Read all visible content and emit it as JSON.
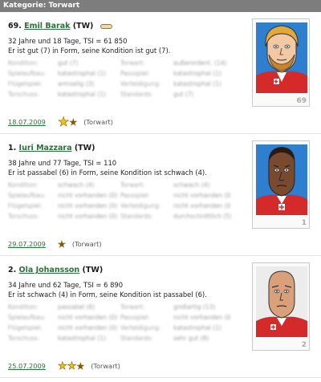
{
  "category": {
    "title": "Kategorie: Torwart"
  },
  "players": [
    {
      "rank": "69.",
      "name": "Emil Barak",
      "pos_code": "(TW)",
      "injury": "bandage-icon",
      "age_tsi": "32 Jahre und 18 Tage, TSI = 61 850",
      "form": "Er ist gut (7) in Form, seine Kondition ist gut (7).",
      "skills": [
        [
          "Kondition:",
          "gut (7)",
          "Torwart:",
          "außerordent. (14)"
        ],
        [
          "Spielaufbau:",
          "katastrophal (1)",
          "Passspiel:",
          "katastrophal (1)"
        ],
        [
          "Flügelspiel:",
          "armselig (3)",
          "Verteidigung:",
          "katastrophal (1)"
        ],
        [
          "Torschuss:",
          "katastrophal (1)",
          "Standards:",
          "gut (7)"
        ]
      ],
      "date": "18.07.2009",
      "stars": "1.5",
      "pos_label": "(Torwart)",
      "card_number": "69",
      "colors": {
        "skin": "#f2c9a3",
        "hair": "#e0a93a",
        "beard": "#c7842a",
        "shirt": "#d42a2a",
        "bg": "#2f7fd0"
      }
    },
    {
      "rank": "1.",
      "name": "Iuri Mazzara",
      "pos_code": "(TW)",
      "age_tsi": "38 Jahre und 77 Tage, TSI = 110",
      "form": "Er ist passabel (6) in Form, seine Kondition ist schwach (4).",
      "skills": [
        [
          "Kondition:",
          "schwach (4)",
          "Torwart:",
          "schwach (4)"
        ],
        [
          "Spielaufbau:",
          "nicht vorhanden (0)",
          "Passspiel:",
          "nicht vorhanden (0)"
        ],
        [
          "Flügelspiel:",
          "nicht vorhanden (0)",
          "Verteidigung:",
          "nicht vorhanden (0)"
        ],
        [
          "Torschuss:",
          "nicht vorhanden (0)",
          "Standards:",
          "durchschnittlich (5)"
        ]
      ],
      "date": "29.07.2009",
      "stars": "0.5",
      "pos_label": "(Torwart)",
      "card_number": "1",
      "colors": {
        "skin": "#7a4a2e",
        "hair": "#2a1a12",
        "beard": "#2a1a12",
        "shirt": "#d42a2a",
        "bg": "#2f7fd0"
      }
    },
    {
      "rank": "2.",
      "name": "Ola Johansson",
      "pos_code": "(TW)",
      "age_tsi": "34 Jahre und 62 Tage, TSI = 6 890",
      "form": "Er ist schwach (4) in Form, seine Kondition ist passabel (6).",
      "skills": [
        [
          "Kondition:",
          "passabel (6)",
          "Torwart:",
          "großartig (13)"
        ],
        [
          "Spielaufbau:",
          "nicht vorhanden (0)",
          "Passspiel:",
          "nicht vorhanden (0)"
        ],
        [
          "Flügelspiel:",
          "nicht vorhanden (0)",
          "Verteidigung:",
          "katastrophal (1)"
        ],
        [
          "Torschuss:",
          "katastrophal (1)",
          "Standards:",
          "sehr gut (8)"
        ]
      ],
      "date": "25.07.2009",
      "stars": "2.5",
      "pos_label": "(Torwart)",
      "card_number": "2",
      "colors": {
        "skin": "#d9a07a",
        "hair": "#c98a64",
        "beard": "#b57a55",
        "shirt": "#d42a2a",
        "bg": "#e9e9e9"
      }
    }
  ]
}
